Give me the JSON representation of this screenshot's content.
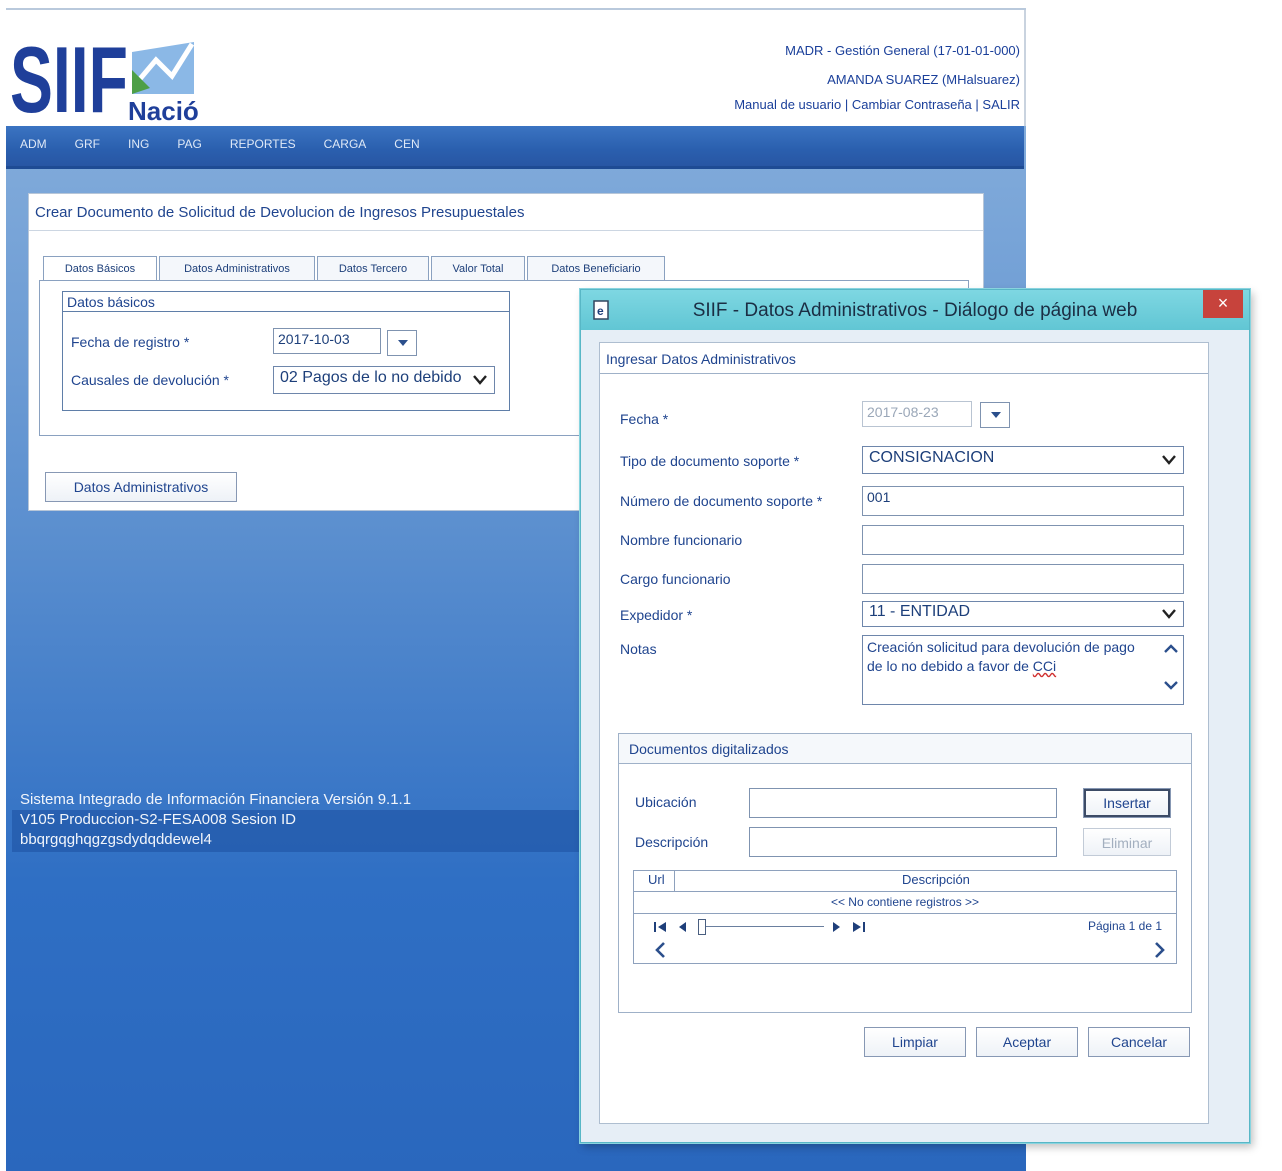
{
  "header": {
    "entity": "MADR - Gestión General (17-01-01-000)",
    "user": "AMANDA SUAREZ (MHalsuarez)",
    "links": [
      "Manual de usuario",
      "Cambiar Contraseña",
      "SALIR"
    ],
    "separator": "|",
    "logo_text": "SIIF",
    "logo_subtext": "Nación"
  },
  "menu": [
    "ADM",
    "GRF",
    "ING",
    "PAG",
    "REPORTES",
    "CARGA",
    "CEN"
  ],
  "main": {
    "title": "Crear Documento de Solicitud de Devolucion de Ingresos Presupuestales",
    "tabs": [
      "Datos Básicos",
      "Datos Administrativos",
      "Datos Tercero",
      "Valor Total",
      "Datos Beneficiario"
    ],
    "basicos": {
      "title": "Datos básicos",
      "fecha_label": "Fecha de registro *",
      "fecha_value": "2017-10-03",
      "causal_label": "Causales de devolución *",
      "causal_value": "02 Pagos de lo no debido"
    },
    "admin_button": "Datos Administrativos"
  },
  "footer": {
    "line1": "Sistema Integrado de Información Financiera Versión 9.1.1",
    "line2": "V105 Produccion-S2-FESA008 Sesion ID",
    "line3": "bbqrgqghqgzgsdydqddewel4"
  },
  "dialog": {
    "title": "SIIF - Datos Administrativos - Diálogo de página web",
    "close": "×",
    "section_title": "Ingresar Datos Administrativos",
    "fields": {
      "fecha_label": "Fecha *",
      "fecha_value": "2017-08-23",
      "tipo_label": "Tipo de documento soporte *",
      "tipo_value": "CONSIGNACION",
      "numero_label": "Número de documento soporte *",
      "numero_value": "001",
      "nombre_label": "Nombre funcionario",
      "cargo_label": "Cargo funcionario",
      "expedidor_label": "Expedidor *",
      "expedidor_value": "11 - ENTIDAD",
      "notas_label": "Notas",
      "notas_line1": "Creación solicitud para devolución de pago",
      "notas_line2_a": "de lo no debido a favor de ",
      "notas_line2_b": "CCi"
    },
    "docs": {
      "title": "Documentos digitalizados",
      "ubicacion_label": "Ubicación",
      "descripcion_label": "Descripción",
      "insertar": "Insertar",
      "eliminar": "Eliminar",
      "col_url": "Url",
      "col_desc": "Descripción",
      "empty": "<< No contiene registros >>",
      "page_info": "Página 1 de 1"
    },
    "buttons": [
      "Limpiar",
      "Aceptar",
      "Cancelar"
    ]
  },
  "colors": {
    "brand_blue": "#1f4fa6",
    "dialog_titlebar": "#61c6d4",
    "close_red": "#c7433c"
  }
}
